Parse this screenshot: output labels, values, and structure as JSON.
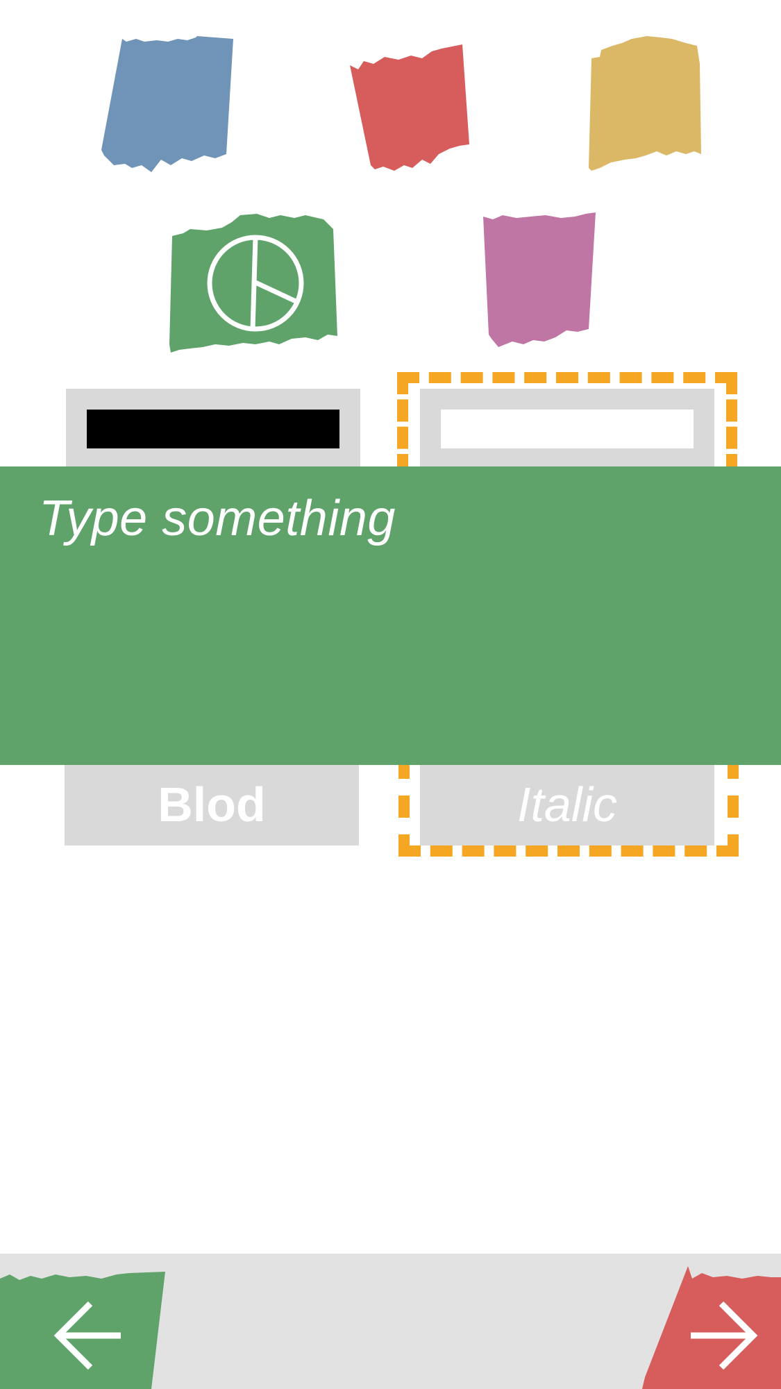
{
  "palette": {
    "swatches": [
      {
        "name": "blue",
        "color": "#6f94b8",
        "selected": false
      },
      {
        "name": "red",
        "color": "#d75c5c",
        "selected": false
      },
      {
        "name": "yellow",
        "color": "#dbb866",
        "selected": false
      },
      {
        "name": "green",
        "color": "#5fa36b",
        "selected": true,
        "icon": "peace-icon"
      },
      {
        "name": "pink",
        "color": "#c076a5",
        "selected": false
      }
    ]
  },
  "text_color_options": [
    {
      "name": "black-text",
      "color": "#000000",
      "selected": false
    },
    {
      "name": "white-text",
      "color": "#ffffff",
      "selected": true
    }
  ],
  "editor": {
    "placeholder": "Type something",
    "background": "#5fa36b"
  },
  "font_style_options": {
    "bold_label": "Blod",
    "italic_label": "Italic",
    "selected": "italic"
  },
  "accent": "#f5a623",
  "navigation": {
    "back_icon": "arrow-left-icon",
    "next_icon": "arrow-right-icon",
    "back_color": "#5fa36b",
    "next_color": "#d75c5c"
  }
}
